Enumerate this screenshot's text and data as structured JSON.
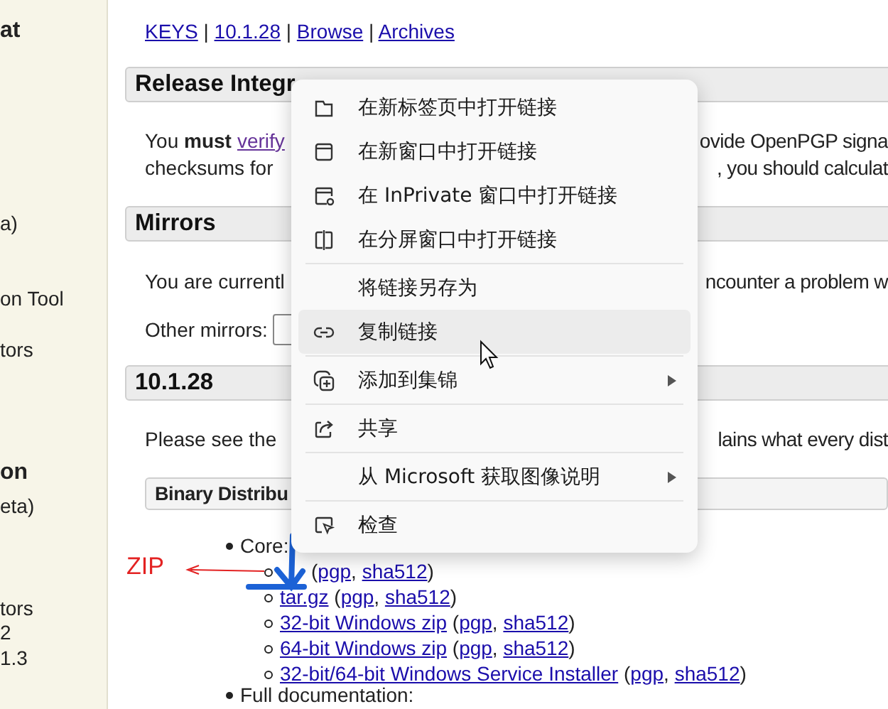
{
  "sidebar": {
    "items": [
      {
        "text": "at",
        "kind": "heading"
      },
      {
        "text": "a)",
        "kind": "item"
      },
      {
        "text": "on Tool",
        "kind": "item"
      },
      {
        "text": "tors",
        "kind": "item"
      },
      {
        "text": "on",
        "kind": "heading"
      },
      {
        "text": "eta)",
        "kind": "item"
      },
      {
        "text": "tors",
        "kind": "item"
      },
      {
        "text": "2",
        "kind": "item"
      },
      {
        "text": "1.3",
        "kind": "item"
      }
    ]
  },
  "nav": {
    "parts": [
      {
        "kind": "link",
        "text": "KEYS"
      },
      {
        "kind": "text",
        "text": " | "
      },
      {
        "kind": "link",
        "text": "10.1.28"
      },
      {
        "kind": "text",
        "text": " | "
      },
      {
        "kind": "link",
        "text": "Browse"
      },
      {
        "kind": "text",
        "text": " | "
      },
      {
        "kind": "link",
        "text": "Archives"
      }
    ]
  },
  "release_integrity": {
    "header": "Release Integr",
    "lines": [
      {
        "left": [
          {
            "kind": "text",
            "text": "You "
          },
          {
            "kind": "bold",
            "text": "must"
          },
          {
            "kind": "visited_link",
            "text": "verify"
          }
        ],
        "right": "ovide OpenPGP signa"
      },
      {
        "left": [
          {
            "kind": "text",
            "text": "checksums for"
          }
        ],
        "right": ", you should calculat"
      }
    ]
  },
  "mirrors": {
    "header": "Mirrors",
    "lines": [
      {
        "left": [
          {
            "kind": "text",
            "text": "You are currentl"
          }
        ],
        "right": "ncounter a problem w"
      }
    ],
    "other_label": "Other mirrors:"
  },
  "version": {
    "header": "10.1.28",
    "lines": [
      {
        "left": [
          {
            "kind": "text",
            "text": "Please see the"
          }
        ],
        "right": "lains what every dist"
      }
    ],
    "subheader": "Binary Distribu",
    "list": [
      {
        "text": "Core:",
        "children": [
          {
            "parts": [
              {
                "kind": "text",
                "text": "("
              },
              {
                "kind": "link",
                "text": "pgp"
              },
              {
                "kind": "text",
                "text": ", "
              },
              {
                "kind": "link",
                "text": "sha512"
              },
              {
                "kind": "text",
                "text": ")"
              }
            ]
          },
          {
            "parts": [
              {
                "kind": "link",
                "text": "tar.gz"
              },
              {
                "kind": "text",
                "text": " ("
              },
              {
                "kind": "link",
                "text": "pgp"
              },
              {
                "kind": "text",
                "text": ", "
              },
              {
                "kind": "link",
                "text": "sha512"
              },
              {
                "kind": "text",
                "text": ")"
              }
            ]
          },
          {
            "parts": [
              {
                "kind": "link",
                "text": "32-bit Windows zip"
              },
              {
                "kind": "text",
                "text": " ("
              },
              {
                "kind": "link",
                "text": "pgp"
              },
              {
                "kind": "text",
                "text": ", "
              },
              {
                "kind": "link",
                "text": "sha512"
              },
              {
                "kind": "text",
                "text": ")"
              }
            ]
          },
          {
            "parts": [
              {
                "kind": "link",
                "text": "64-bit Windows zip"
              },
              {
                "kind": "text",
                "text": " ("
              },
              {
                "kind": "link",
                "text": "pgp"
              },
              {
                "kind": "text",
                "text": ", "
              },
              {
                "kind": "link",
                "text": "sha512"
              },
              {
                "kind": "text",
                "text": ")"
              }
            ]
          },
          {
            "parts": [
              {
                "kind": "link",
                "text": "32-bit/64-bit Windows Service Installer"
              },
              {
                "kind": "text",
                "text": " ("
              },
              {
                "kind": "link",
                "text": "pgp"
              },
              {
                "kind": "text",
                "text": ", "
              },
              {
                "kind": "link",
                "text": "sha512"
              },
              {
                "kind": "text",
                "text": ")"
              }
            ]
          }
        ]
      },
      {
        "text": "Full documentation:"
      }
    ]
  },
  "annotation": {
    "label": "ZIP"
  },
  "context_menu": {
    "items": [
      {
        "label": "在新标签页中打开链接",
        "selected": false,
        "submenu": false,
        "separator_before": false
      },
      {
        "label": "在新窗口中打开链接",
        "selected": false,
        "submenu": false,
        "separator_before": false
      },
      {
        "label": "在 InPrivate 窗口中打开链接",
        "selected": false,
        "submenu": false,
        "separator_before": false
      },
      {
        "label": "在分屏窗口中打开链接",
        "selected": false,
        "submenu": false,
        "separator_before": false
      },
      {
        "label": "将链接另存为",
        "selected": false,
        "submenu": false,
        "separator_before": true
      },
      {
        "label": "复制链接",
        "selected": true,
        "submenu": false,
        "separator_before": false
      },
      {
        "label": "添加到集锦",
        "selected": false,
        "submenu": true,
        "separator_before": true
      },
      {
        "label": "共享",
        "selected": false,
        "submenu": false,
        "separator_before": true
      },
      {
        "label": "从 Microsoft 获取图像说明",
        "selected": false,
        "submenu": true,
        "separator_before": true
      },
      {
        "label": "检查",
        "selected": false,
        "submenu": false,
        "separator_before": true
      }
    ]
  }
}
